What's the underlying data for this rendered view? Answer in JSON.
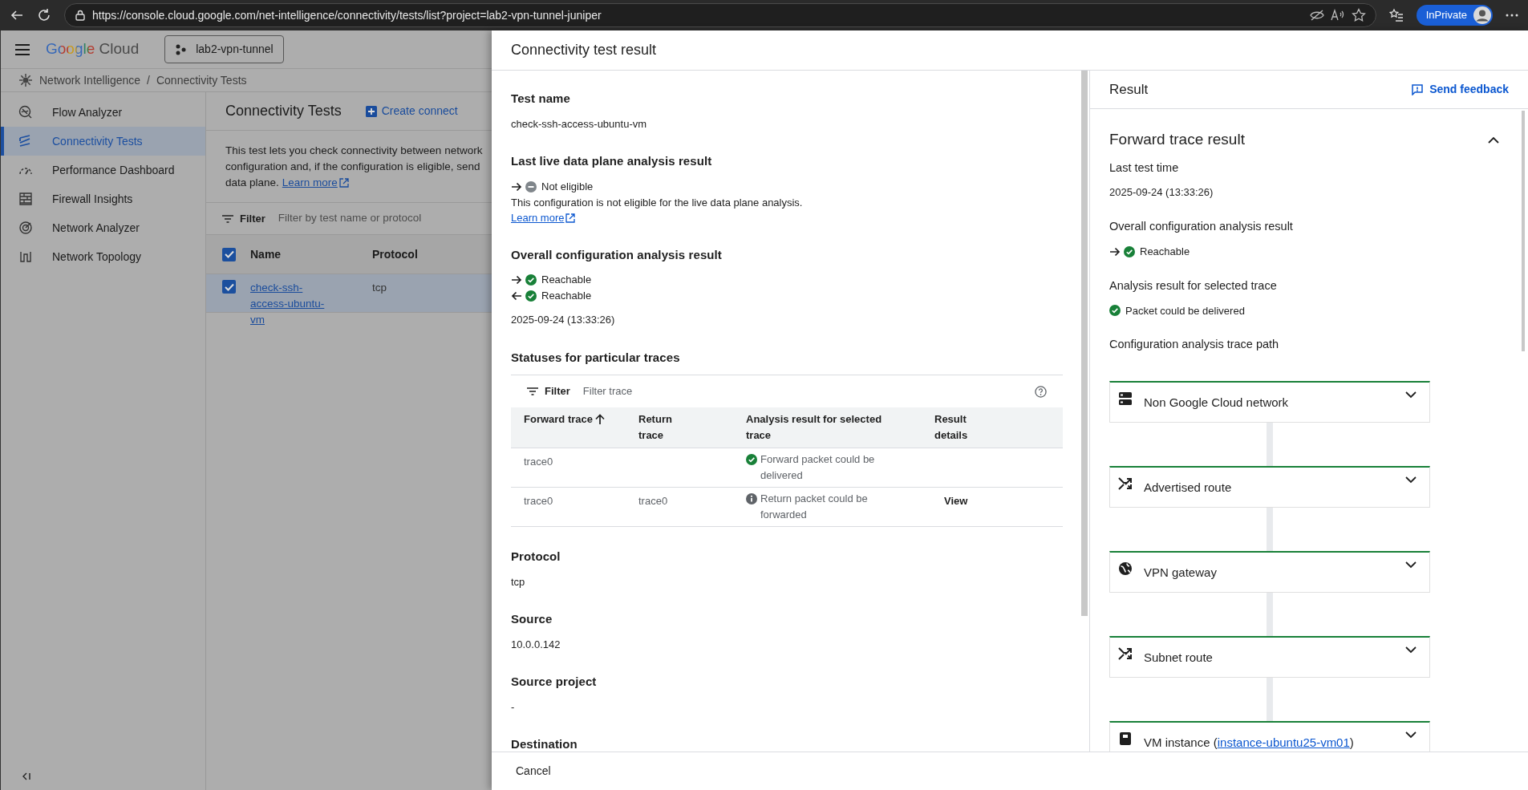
{
  "browser": {
    "url": "https://console.cloud.google.com/net-intelligence/connectivity/tests/list?project=lab2-vpn-tunnel-juniper",
    "profile_label": "InPrivate"
  },
  "console": {
    "logo_brand": "Google",
    "logo_product": "Cloud",
    "project": "lab2-vpn-tunnel",
    "breadcrumb": [
      "Network Intelligence",
      "Connectivity Tests"
    ],
    "breadcrumb_separator": "/",
    "sidebar": {
      "items": [
        {
          "label": "Flow Analyzer",
          "kind": "flow",
          "selected": false
        },
        {
          "label": "Connectivity Tests",
          "kind": "connectivity",
          "selected": true
        },
        {
          "label": "Performance Dashboard",
          "kind": "performance",
          "selected": false
        },
        {
          "label": "Firewall Insights",
          "kind": "firewall",
          "selected": false
        },
        {
          "label": "Network Analyzer",
          "kind": "analyzer",
          "selected": false
        },
        {
          "label": "Network Topology",
          "kind": "topology",
          "selected": false
        }
      ]
    },
    "page": {
      "title": "Connectivity Tests",
      "create_button": "Create connect",
      "description_lines": [
        "This test lets you check connectivity between network",
        "configuration and, if the configuration is eligible, send",
        "data plane."
      ],
      "description_link": "Learn more",
      "filter": {
        "label": "Filter",
        "placeholder": "Filter by test name or protocol"
      },
      "table": {
        "all_checked": true,
        "columns": [
          "Name",
          "Protocol"
        ],
        "rows": [
          {
            "checked": true,
            "name": "check-ssh-access-ubuntu-vm",
            "protocol": "tcp"
          }
        ]
      }
    }
  },
  "drawer": {
    "title": "Connectivity test result",
    "details": [
      {
        "label": "Test name",
        "value": "check-ssh-access-ubuntu-vm"
      },
      {
        "label": "Last live data plane analysis result",
        "statuses": [
          {
            "kind": "forward_blocked",
            "text": "Not eligible"
          }
        ],
        "note": "This configuration is not eligible for the live data plane analysis.",
        "link": "Learn more"
      },
      {
        "label": "Overall configuration analysis result",
        "statuses": [
          {
            "kind": "forward_ok",
            "text": "Reachable"
          },
          {
            "kind": "return_ok",
            "text": "Reachable"
          }
        ],
        "value": "2025-09-24 (13:33:26)"
      },
      {
        "label": "Statuses for particular traces",
        "table": {
          "filter_label": "Filter",
          "filter_placeholder": "Filter trace",
          "columns": [
            {
              "label": "Forward trace",
              "sorted": true
            },
            {
              "label": "Return trace",
              "sorted": false
            },
            {
              "label": "Analysis result for selected trace",
              "sorted": false
            },
            {
              "label": "Result details",
              "sorted": false
            }
          ],
          "rows": [
            {
              "forward": "trace0",
              "kind": "ok",
              "result": "Forward packet could be delivered"
            },
            {
              "forward": "trace0",
              "return": "trace0",
              "kind": "info",
              "result": "Return packet could be forwarded",
              "action": "View"
            }
          ]
        }
      },
      {
        "label": "Protocol",
        "value": "tcp"
      },
      {
        "label": "Source",
        "value": "10.0.0.142"
      },
      {
        "label": "Source project",
        "value": "-"
      },
      {
        "label": "Destination"
      }
    ],
    "result": {
      "title": "Result",
      "feedback": "Send feedback",
      "section_title": "Forward trace result",
      "expanded": true,
      "fields": [
        {
          "label": "Last test time",
          "value": "2025-09-24 (13:33:26)"
        },
        {
          "label": "Overall configuration analysis result",
          "status": {
            "kind": "forward_ok",
            "text": "Reachable"
          }
        },
        {
          "label": "Analysis result for selected trace",
          "status": {
            "kind": "ok",
            "text": "Packet could be delivered"
          }
        }
      ],
      "path_label": "Configuration analysis trace path",
      "steps": [
        {
          "kind": "network",
          "label": "Non Google Cloud network"
        },
        {
          "kind": "route",
          "label": "Advertised route"
        },
        {
          "kind": "globe",
          "label": "VPN gateway"
        },
        {
          "kind": "route",
          "label": "Subnet route"
        },
        {
          "kind": "vm",
          "label": "VM instance (",
          "link": "instance-ubuntu25-vm01",
          "suffix": ")"
        }
      ]
    },
    "cancel": "Cancel"
  }
}
